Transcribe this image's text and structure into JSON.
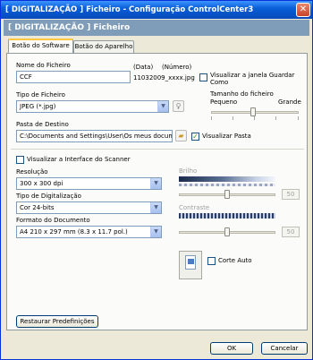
{
  "window": {
    "title": "[ DIGITALIZAÇÃO ]  Ficheiro - Configuração ControlCenter3",
    "close_glyph": "✕",
    "header": "[ DIGITALIZAÇÃO ]  Ficheiro"
  },
  "tabs": [
    {
      "label": "Botão do Software",
      "active": true
    },
    {
      "label": "Botão do Aparelho",
      "active": false
    }
  ],
  "file": {
    "name_label": "Nome do Ficheiro",
    "name_value": "CCF",
    "date_label": "(Data)",
    "number_label": "(Número)",
    "generated_name": "11032009_xxxx.jpg",
    "show_save_as_label": "Visualizar a janela Guardar Como",
    "show_save_as_checked": false,
    "type_label": "Tipo de Ficheiro",
    "type_value": "JPEG (*.jpg)",
    "size_label": "Tamanho do ficheiro",
    "size_small": "Pequeno",
    "size_large": "Grande",
    "folder_label": "Pasta de Destino",
    "folder_value": "C:\\Documents and Settings\\User\\Os meus document",
    "show_folder_label": "Visualizar Pasta",
    "show_folder_checked": true
  },
  "scanner": {
    "show_interface_label": "Visualizar a Interface do Scanner",
    "show_interface_checked": false,
    "resolution_label": "Resolução",
    "resolution_value": "300 x 300 dpi",
    "scan_type_label": "Tipo de Digitalização",
    "scan_type_value": "Cor 24-bits",
    "doc_format_label": "Formato do Documento",
    "doc_format_value": "A4 210 x 297 mm (8.3 x 11.7 pol.)",
    "brightness_label": "Brilho",
    "brightness_value": "50",
    "contrast_label": "Contraste",
    "contrast_value": "50",
    "auto_crop_label": "Corte Auto",
    "auto_crop_checked": false
  },
  "buttons": {
    "restore_defaults": "Restaurar Predefinições",
    "ok": "OK",
    "cancel": "Cancelar"
  },
  "colors": {
    "title_blue": "#0a5fd8",
    "header_band": "#7f9db9",
    "check_green": "#21a121"
  }
}
